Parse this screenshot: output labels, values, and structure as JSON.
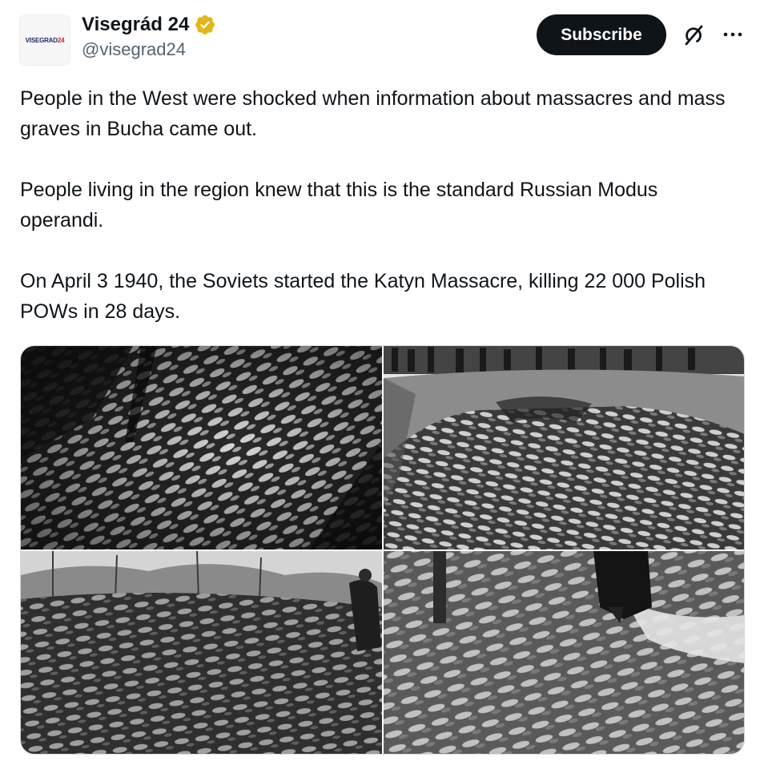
{
  "author": {
    "avatar_text_main": "VISEGRAD",
    "avatar_text_accent": "24",
    "display_name": "Visegrád 24",
    "handle": "@visegrad24",
    "verified_icon": "gold-verified-badge-icon",
    "verified_color": "#e2b719"
  },
  "actions": {
    "subscribe_label": "Subscribe",
    "subscribe_bg": "#0f1419",
    "grok_icon": "grok-icon",
    "more_icon": "more-icon"
  },
  "tweet": {
    "paragraphs": [
      "People in the West were shocked when information about massacres and mass graves in Bucha came out.",
      "People living in the region knew that this is the standard Russian Modus operandi.",
      "On April 3 1940, the Soviets started the Katyn Massacre, killing 22 000 Polish POWs in 28 days."
    ]
  },
  "media": {
    "photo_count": 4,
    "style": "black-and-white historical photographs"
  }
}
